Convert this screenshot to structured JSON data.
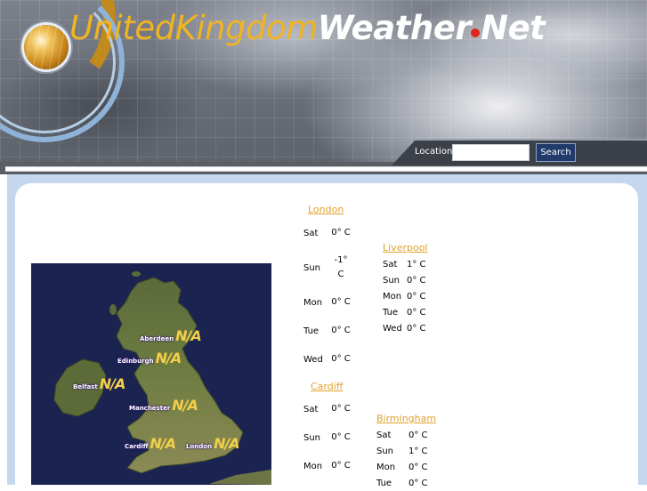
{
  "site": {
    "title_part1": "UnitedKingdom",
    "title_part2": "Weather",
    "title_part3": "Net"
  },
  "search": {
    "label": "Location",
    "placeholder": "",
    "value": "",
    "button": "Search"
  },
  "map": {
    "cities": [
      {
        "name": "Aberdeen",
        "value": "N/A"
      },
      {
        "name": "Edinburgh",
        "value": "N/A"
      },
      {
        "name": "Belfast",
        "value": "N/A"
      },
      {
        "name": "Manchester",
        "value": "N/A"
      },
      {
        "name": "Cardiff",
        "value": "N/A"
      },
      {
        "name": "London",
        "value": "N/A"
      }
    ]
  },
  "forecasts": {
    "london": {
      "city": "London",
      "days": [
        {
          "day": "Sat",
          "temp": "0° C"
        },
        {
          "day": "Sun",
          "temp": "-1° C"
        },
        {
          "day": "Mon",
          "temp": "0° C"
        },
        {
          "day": "Tue",
          "temp": "0° C"
        },
        {
          "day": "Wed",
          "temp": "0° C"
        }
      ]
    },
    "cardiff": {
      "city": "Cardiff",
      "days": [
        {
          "day": "Sat",
          "temp": "0° C"
        },
        {
          "day": "Sun",
          "temp": "0° C"
        },
        {
          "day": "Mon",
          "temp": "0° C"
        }
      ]
    },
    "liverpool": {
      "city": "Liverpool",
      "days": [
        {
          "day": "Sat",
          "temp": "1° C"
        },
        {
          "day": "Sun",
          "temp": "0° C"
        },
        {
          "day": "Mon",
          "temp": "0° C"
        },
        {
          "day": "Tue",
          "temp": "0° C"
        },
        {
          "day": "Wed",
          "temp": "0° C"
        }
      ]
    },
    "birmingham": {
      "city": "Birmingham",
      "days": [
        {
          "day": "Sat",
          "temp": "0° C"
        },
        {
          "day": "Sun",
          "temp": "1° C"
        },
        {
          "day": "Mon",
          "temp": "0° C"
        },
        {
          "day": "Tue",
          "temp": "0° C"
        }
      ]
    }
  },
  "colors": {
    "accent_orange": "#f0b323",
    "link_orange": "#e1a22c",
    "frame_blue": "#c5d7ef",
    "button_navy": "#213a6b",
    "logo_dot_red": "#e0241b"
  }
}
